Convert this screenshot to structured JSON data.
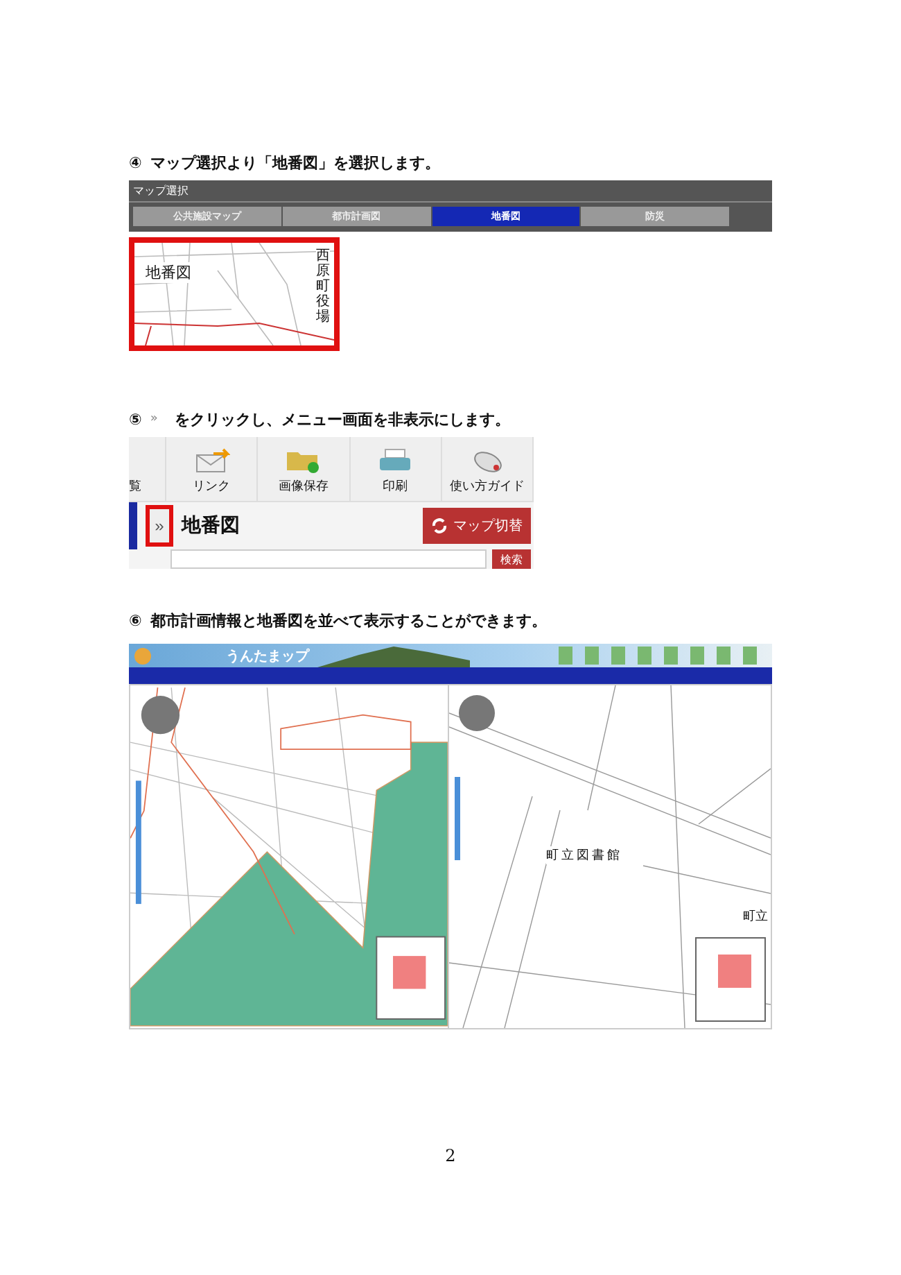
{
  "step4": {
    "number": "④",
    "text": "マップ選択より「地番図」を選択します。",
    "map_select": {
      "title": "マップ選択",
      "tabs": [
        {
          "label": "公共施設マップ",
          "selected": false
        },
        {
          "label": "都市計画図",
          "selected": false
        },
        {
          "label": "地番図",
          "selected": true
        },
        {
          "label": "防災",
          "selected": false
        }
      ]
    },
    "thumbnail": {
      "label": "地番図",
      "place_label": "西原町役場"
    }
  },
  "step5": {
    "number": "⑤",
    "icon_glyph": "»",
    "text": "をクリックし、メニュー画面を非表示にします。",
    "toolbar": [
      {
        "label": "覧",
        "kind": "none"
      },
      {
        "label": "リンク",
        "kind": "envelope"
      },
      {
        "label": "画像保存",
        "kind": "folder"
      },
      {
        "label": "印刷",
        "kind": "printer"
      },
      {
        "label": "使い方ガイド",
        "kind": "mouse"
      }
    ],
    "collapse_button": "»",
    "map_name": "地番図",
    "switch_button": "マップ切替",
    "search_button": "検索"
  },
  "step6": {
    "number": "⑥",
    "text": "都市計画情報と地番図を並べて表示することができます。",
    "app_title": "うんたまップ",
    "map_labels": [
      "町立図書館",
      "町立"
    ]
  },
  "page_number": "2"
}
